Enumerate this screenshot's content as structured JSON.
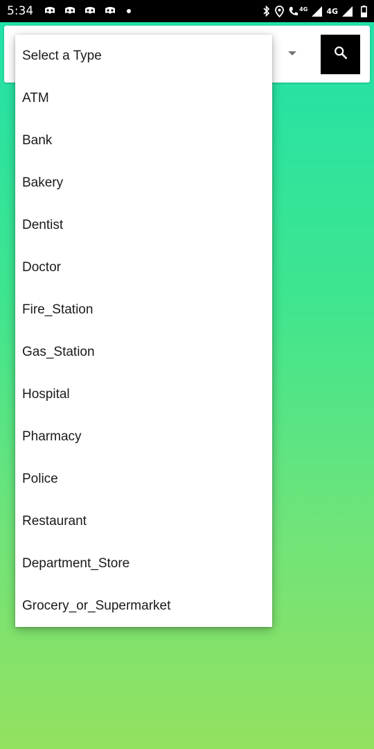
{
  "status_bar": {
    "time": "5:34",
    "network_1": "4G",
    "network_2": "4G",
    "icons": [
      "notification-app-icon",
      "notification-app-icon",
      "notification-app-icon",
      "notification-app-icon",
      "more-notifications-dot",
      "bluetooth-icon",
      "location-icon",
      "volte-call-icon",
      "signal-icon",
      "signal-icon",
      "battery-icon"
    ]
  },
  "search_bar": {
    "selected_value": "Select a Type",
    "search_icon": "search-icon",
    "button_color": "#000000"
  },
  "dropdown": {
    "items": [
      {
        "label": "Select a Type"
      },
      {
        "label": "ATM"
      },
      {
        "label": "Bank"
      },
      {
        "label": "Bakery"
      },
      {
        "label": "Dentist"
      },
      {
        "label": "Doctor"
      },
      {
        "label": "Fire_Station"
      },
      {
        "label": "Gas_Station"
      },
      {
        "label": "Hospital"
      },
      {
        "label": "Pharmacy"
      },
      {
        "label": "Police"
      },
      {
        "label": "Restaurant"
      },
      {
        "label": "Department_Store"
      },
      {
        "label": "Grocery_or_Supermarket"
      }
    ]
  },
  "colors": {
    "background_top": "#1fe1aa",
    "background_bottom": "#93e15f"
  }
}
